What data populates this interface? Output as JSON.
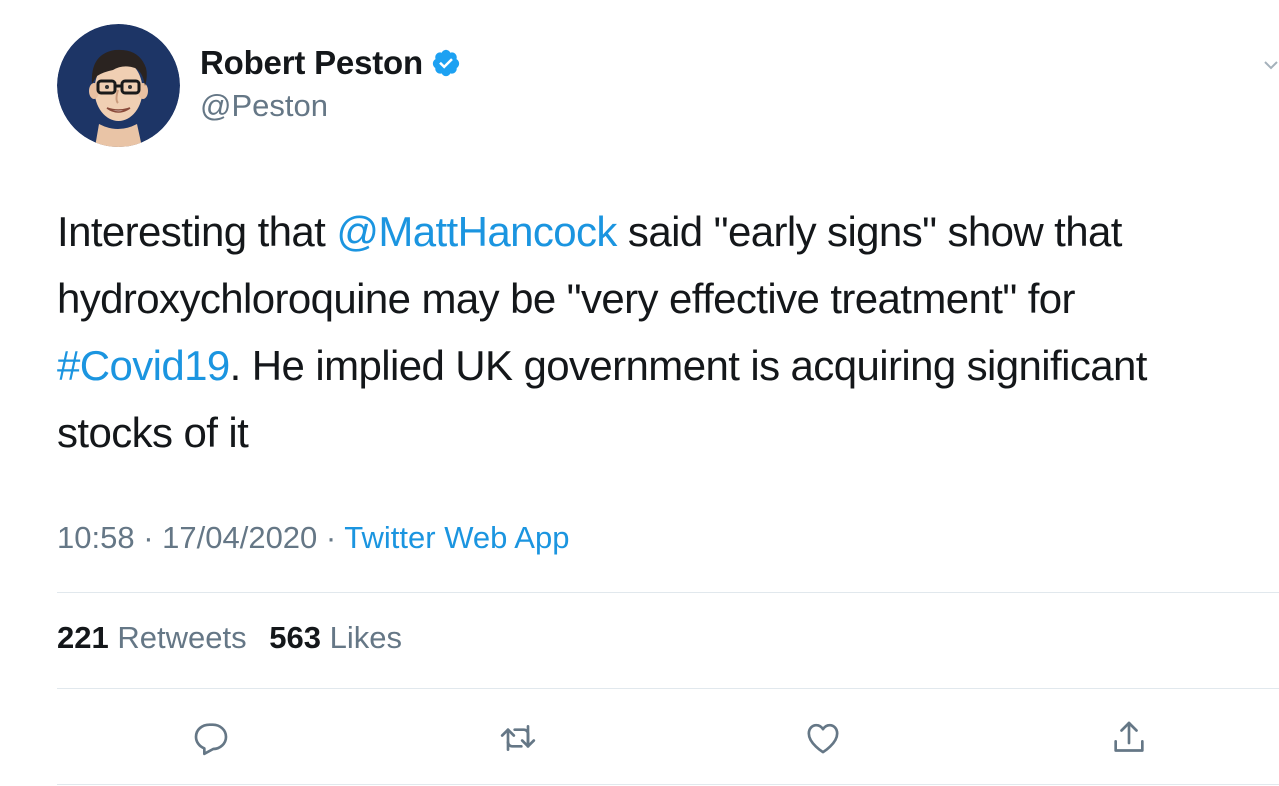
{
  "author": {
    "display_name": "Robert Peston",
    "handle": "@Peston",
    "verified": true
  },
  "tweet": {
    "text_before_mention": "Interesting that ",
    "mention": "@MattHancock",
    "text_after_mention": " said \"early signs\" show that hydroxychloroquine may be \"very effective treatment\" for ",
    "hashtag": "#Covid19",
    "text_after_hashtag": ". He implied UK government is acquiring significant stocks of it"
  },
  "meta": {
    "time": "10:58",
    "separator_1": " · ",
    "date": "17/04/2020",
    "separator_2": " · ",
    "source": "Twitter Web App"
  },
  "stats": {
    "retweets_count": "221",
    "retweets_label": "Retweets",
    "likes_count": "563",
    "likes_label": "Likes"
  },
  "actions": [
    "reply-icon",
    "retweet-icon",
    "like-icon",
    "share-icon"
  ],
  "colors": {
    "link": "#1b95e0",
    "text": "#14171a",
    "secondary": "#657786",
    "divider": "#e1e8ed",
    "verified": "#1da1f2"
  }
}
